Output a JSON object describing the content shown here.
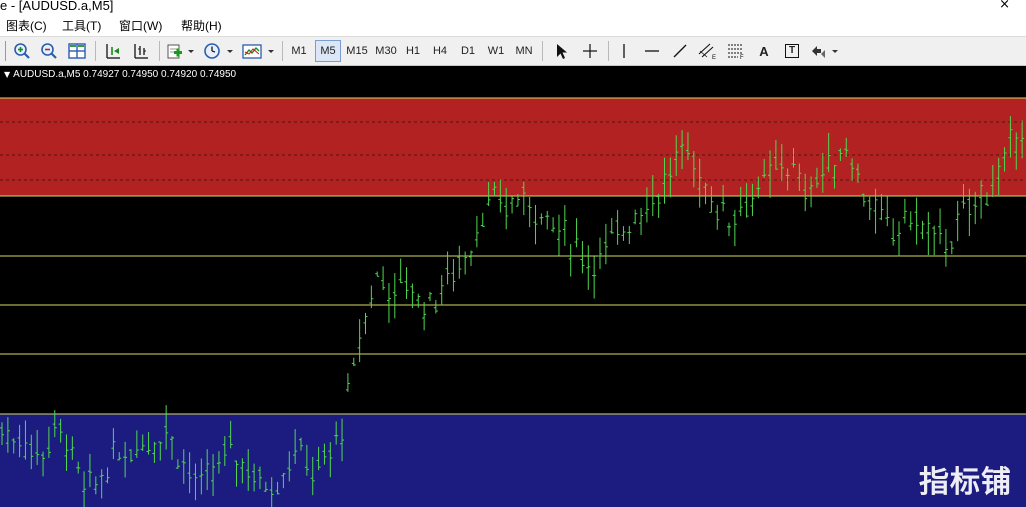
{
  "window": {
    "title": "e - [AUDUSD.a,M5]",
    "close_glyph": "×"
  },
  "menu": {
    "items": [
      {
        "label": "图表(C)"
      },
      {
        "label": "工具(T)"
      },
      {
        "label": "窗口(W)"
      },
      {
        "label": "帮助(H)"
      }
    ]
  },
  "toolbar": {
    "icons": {
      "zoom_in": "zoom-in-icon",
      "zoom_out": "zoom-out-icon",
      "tile": "tile-windows-icon",
      "scroll": "chart-shift-icon",
      "autoscroll": "auto-scroll-icon",
      "indicators": "indicators-icon",
      "periods": "clock-icon",
      "templates": "templates-icon"
    },
    "timeframes": [
      "M1",
      "M5",
      "M15",
      "M30",
      "H1",
      "H4",
      "D1",
      "W1",
      "MN"
    ],
    "active_timeframe": "M5",
    "text_tool_label": "A",
    "label_tool_label": "T"
  },
  "chart": {
    "symbol_info": "AUDUSD.a,M5  0.74927 0.74950 0.74920 0.74950",
    "colors": {
      "background": "#000000",
      "resistance_zone": "#b22222",
      "support_zone": "#1c1c80",
      "level_line": "#d8d860",
      "bars": "#4fd84f",
      "grid_dash": "#000000"
    },
    "price_seed": [
      0.742,
      0.7415,
      0.7418,
      0.7412,
      0.741,
      0.7414,
      0.742,
      0.7416,
      0.7405,
      0.7395,
      0.7398,
      0.7402,
      0.7408,
      0.741,
      0.7412,
      0.7415,
      0.7414,
      0.7418,
      0.742,
      0.7412,
      0.7405,
      0.74,
      0.7398,
      0.7403,
      0.7408,
      0.7412,
      0.7408,
      0.7404,
      0.74,
      0.7398,
      0.74,
      0.7406,
      0.7412,
      0.7408,
      0.7402,
      0.7406,
      0.7412,
      0.742,
      0.7438,
      0.7455,
      0.747,
      0.748,
      0.7475,
      0.747,
      0.7478,
      0.7472,
      0.7468,
      0.747,
      0.7475,
      0.748,
      0.7486,
      0.749,
      0.7502,
      0.7505,
      0.7508,
      0.7505,
      0.751,
      0.7508,
      0.7506,
      0.7502,
      0.7498,
      0.7495,
      0.7492,
      0.7488,
      0.7484,
      0.7486,
      0.749,
      0.7495,
      0.75,
      0.7504,
      0.7506,
      0.751,
      0.7515,
      0.752,
      0.7528,
      0.7523,
      0.7518,
      0.751,
      0.7505,
      0.7502,
      0.7505,
      0.7508,
      0.751,
      0.7514,
      0.752,
      0.7524,
      0.752,
      0.7512,
      0.7515,
      0.7518,
      0.752,
      0.7526,
      0.753,
      0.752,
      0.751,
      0.7504,
      0.7498,
      0.7495,
      0.75,
      0.7502,
      0.7498,
      0.7496,
      0.7493,
      0.7492,
      0.7498,
      0.7505,
      0.7508,
      0.7512,
      0.7515,
      0.752,
      0.7532,
      0.7538
    ]
  },
  "watermark": "指标铺"
}
